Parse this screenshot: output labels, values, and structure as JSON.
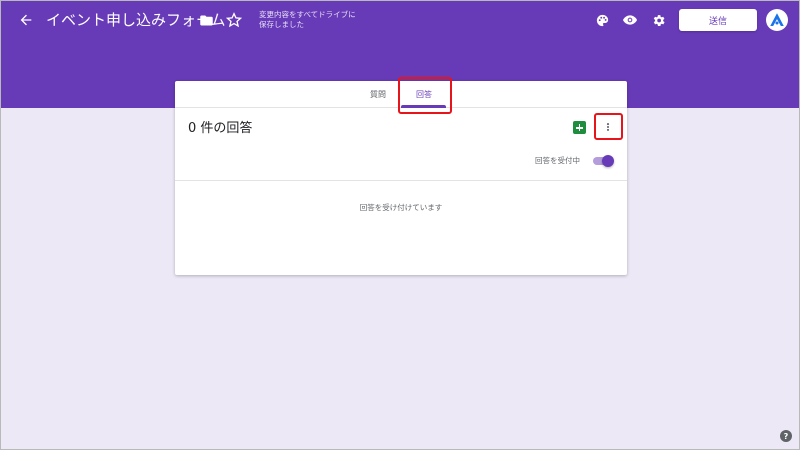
{
  "header": {
    "title": "イベント申し込みフォーム",
    "save_status_line1": "変更内容をすべてドライブに",
    "save_status_line2": "保存しました",
    "send_label": "送信",
    "icons": [
      "back-arrow-icon",
      "folder-icon",
      "star-icon",
      "palette-icon",
      "preview-eye-icon",
      "settings-gear-icon",
      "more-vert-icon",
      "account-avatar-icon"
    ]
  },
  "tabs": [
    {
      "label": "質問",
      "active": false
    },
    {
      "label": "回答",
      "active": true
    }
  ],
  "responses": {
    "count_label": "0 件の回答",
    "accepting_label": "回答を受付中",
    "accepting_enabled": true,
    "status_message": "回答を受け付けています",
    "icons": [
      "google-sheets-icon",
      "more-vert-icon"
    ]
  },
  "help": {
    "label": "?"
  },
  "colors": {
    "header": "#673ab7",
    "background": "#ece8f6",
    "accent": "#673ab7",
    "sheets": "#1e8e3e",
    "highlight": "#e8141c"
  }
}
